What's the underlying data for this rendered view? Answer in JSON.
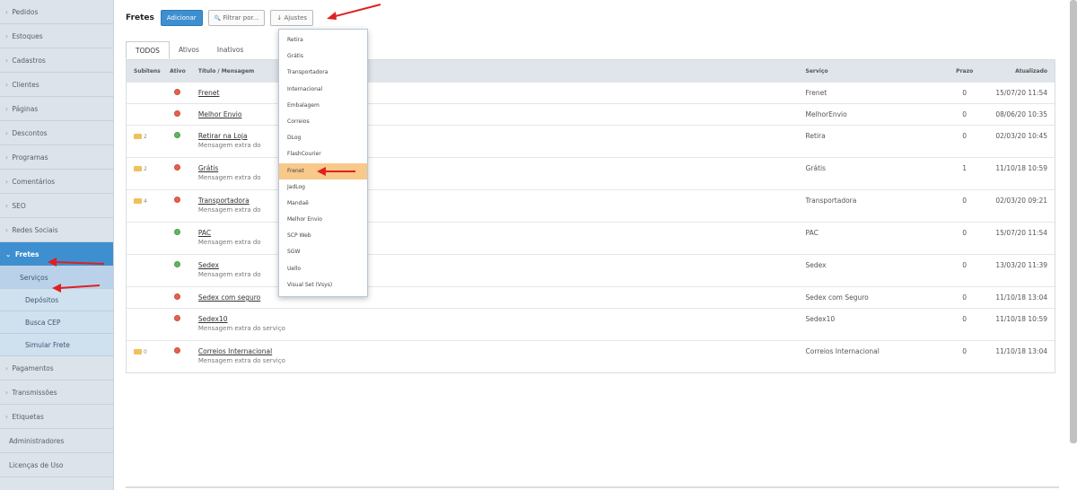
{
  "sidebar": {
    "items": [
      {
        "label": "Pedidos",
        "chevron": "›"
      },
      {
        "label": "Estoques",
        "chevron": "›"
      },
      {
        "label": "Cadastros",
        "chevron": "›"
      },
      {
        "label": "Clientes",
        "chevron": "›"
      },
      {
        "label": "Páginas",
        "chevron": "›"
      },
      {
        "label": "Descontos",
        "chevron": "›"
      },
      {
        "label": "Programas",
        "chevron": "›"
      },
      {
        "label": "Comentários",
        "chevron": "›"
      },
      {
        "label": "SEO",
        "chevron": "›"
      },
      {
        "label": "Redes Sociais",
        "chevron": "›"
      },
      {
        "label": "Fretes",
        "chevron": "⌄"
      }
    ],
    "fretes_sub": [
      {
        "label": "Serviços"
      },
      {
        "label": "Depósitos"
      },
      {
        "label": "Busca CEP"
      },
      {
        "label": "Simular Frete"
      }
    ],
    "items_after": [
      {
        "label": "Pagamentos",
        "chevron": "›"
      },
      {
        "label": "Transmissões",
        "chevron": "›"
      },
      {
        "label": "Etiquetas",
        "chevron": "›"
      },
      {
        "label": "Administradores",
        "chevron": ""
      },
      {
        "label": "Licenças de Uso",
        "chevron": ""
      }
    ]
  },
  "toolbar": {
    "title": "Fretes",
    "add_label": "Adicionar",
    "filter_label": "Filtrar por...",
    "filter_icon": "🔍",
    "settings_label": "Ajustes",
    "settings_icon": "↓"
  },
  "tabs": [
    "TODOS",
    "Ativos",
    "Inativos"
  ],
  "table": {
    "headers": {
      "sub": "Subitens",
      "active": "Ativo",
      "title": "Título / Mensagem",
      "service": "Serviço",
      "deadline": "Prazo",
      "updated": "Atualizado"
    },
    "rows": [
      {
        "sub": "",
        "status": "inactive",
        "title": "Frenet",
        "msg": "",
        "service": "Frenet",
        "deadline": "0",
        "updated": "15/07/20 11:54"
      },
      {
        "sub": "",
        "status": "inactive",
        "title": "Melhor Envio",
        "msg": "",
        "service": "MelhorEnvio",
        "deadline": "0",
        "updated": "08/06/20 10:35"
      },
      {
        "sub": "2",
        "status": "active",
        "title": "Retirar na Loja",
        "msg": "Mensagem extra do",
        "service": "Retira",
        "deadline": "0",
        "updated": "02/03/20 10:45"
      },
      {
        "sub": "2",
        "status": "inactive",
        "title": "Grátis",
        "msg": "Mensagem extra do",
        "service": "Grátis",
        "deadline": "1",
        "updated": "11/10/18 10:59"
      },
      {
        "sub": "4",
        "status": "inactive",
        "title": "Transportadora",
        "msg": "Mensagem extra do",
        "service": "Transportadora",
        "deadline": "0",
        "updated": "02/03/20 09:21"
      },
      {
        "sub": "",
        "status": "active",
        "title": "PAC",
        "msg": "Mensagem extra do",
        "service": "PAC",
        "deadline": "0",
        "updated": "15/07/20 11:54"
      },
      {
        "sub": "",
        "status": "active",
        "title": "Sedex",
        "msg": "Mensagem extra do",
        "service": "Sedex",
        "deadline": "0",
        "updated": "13/03/20 11:39"
      },
      {
        "sub": "",
        "status": "inactive",
        "title": "Sedex com seguro",
        "msg": "",
        "service": "Sedex com Seguro",
        "deadline": "0",
        "updated": "11/10/18 13:04"
      },
      {
        "sub": "",
        "status": "inactive",
        "title": "Sedex10",
        "msg": "Mensagem extra do serviço",
        "service": "Sedex10",
        "deadline": "0",
        "updated": "11/10/18 10:59"
      },
      {
        "sub": "0",
        "status": "inactive",
        "title": "Correios Internacional",
        "msg": "Mensagem extra do serviço",
        "service": "Correios Internacional",
        "deadline": "0",
        "updated": "11/10/18 13:04"
      }
    ]
  },
  "dropdown": {
    "items": [
      "Retira",
      "Grátis",
      "Transportadora",
      "Internacional",
      "Embalagem",
      "Correios",
      "DLog",
      "FlashCourier",
      "Frenet",
      "JadLog",
      "Mandaê",
      "Melhor Envio",
      "SCP Web",
      "SGW",
      "Uello",
      "Visual Set (Vsys)"
    ],
    "highlighted": "Frenet"
  },
  "colors": {
    "accent": "#3e8fd0",
    "status_active": "#5cb85c",
    "status_inactive": "#e8604c",
    "arrow": "#e02020",
    "highlight": "#f8c98a"
  }
}
